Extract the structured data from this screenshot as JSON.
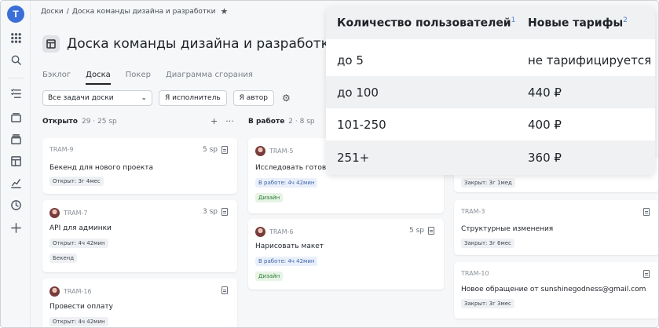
{
  "breadcrumb": {
    "root": "Доски",
    "separator": "/",
    "current": "Доска команды дизайна и разработки"
  },
  "page_title": "Доска команды дизайна и разработки",
  "tabs": [
    {
      "label": "Бэклог",
      "active": false
    },
    {
      "label": "Доска",
      "active": true
    },
    {
      "label": "Покер",
      "active": false
    },
    {
      "label": "Диаграмма сгорания",
      "active": false
    }
  ],
  "toolbar": {
    "filter_select": "Все задачи доски",
    "assignee_btn": "Я исполнитель",
    "author_btn": "Я автор"
  },
  "columns": {
    "open": {
      "name": "Открыто",
      "meta": "29 · 25 sp"
    },
    "in_work": {
      "name": "В работе",
      "meta": "2 · 8 sp"
    }
  },
  "cards": {
    "c1": {
      "id": "TRAM-9",
      "sp": "5 sp",
      "title": "Бекенд для нового проекта",
      "status": "Открыт: 3г 4мес"
    },
    "c2": {
      "id": "TRAM-7",
      "sp": "3 sp",
      "title": "API для админки",
      "status": "Открыт: 4ч 42мин",
      "tag": "Бекенд"
    },
    "c3": {
      "id": "TRAM-16",
      "title": "Провести оплату",
      "status": "Открыт: 4ч 42мин"
    },
    "c4": {
      "id": "TRAM-5",
      "title": "Исследовать готовь",
      "status": "В работе: 4ч 42мин",
      "tag": "Дизайн"
    },
    "c5": {
      "id": "TRAM-6",
      "sp": "5 sp",
      "title": "Нарисовать макет",
      "status": "В работе: 4ч 42мин",
      "tag": "Дизайн"
    },
    "c6": {
      "status": "Закрыт: 3г 1мед"
    },
    "c7": {
      "id": "TRAM-3",
      "title": "Структурные изменения",
      "status": "Закрыт: 3г 6мес"
    },
    "c8": {
      "id": "TRAM-10",
      "title": "Новое обращение от sunshinegodness@gmail.com",
      "status": "Закрыт: 3г 3мес"
    }
  },
  "pricing": {
    "header_users": "Количество пользователей",
    "header_users_note": "1",
    "header_tariff": "Новые тарифы",
    "header_tariff_note": "2",
    "rows": [
      {
        "users": "до 5",
        "price": "не тарифицируется"
      },
      {
        "users": "до 100",
        "price": "440 ₽"
      },
      {
        "users": "101-250",
        "price": "400 ₽"
      },
      {
        "users": "251+",
        "price": "360 ₽"
      }
    ]
  },
  "colors": {
    "accent": "#3b6fd8",
    "footnote": "#4a7ee0"
  }
}
